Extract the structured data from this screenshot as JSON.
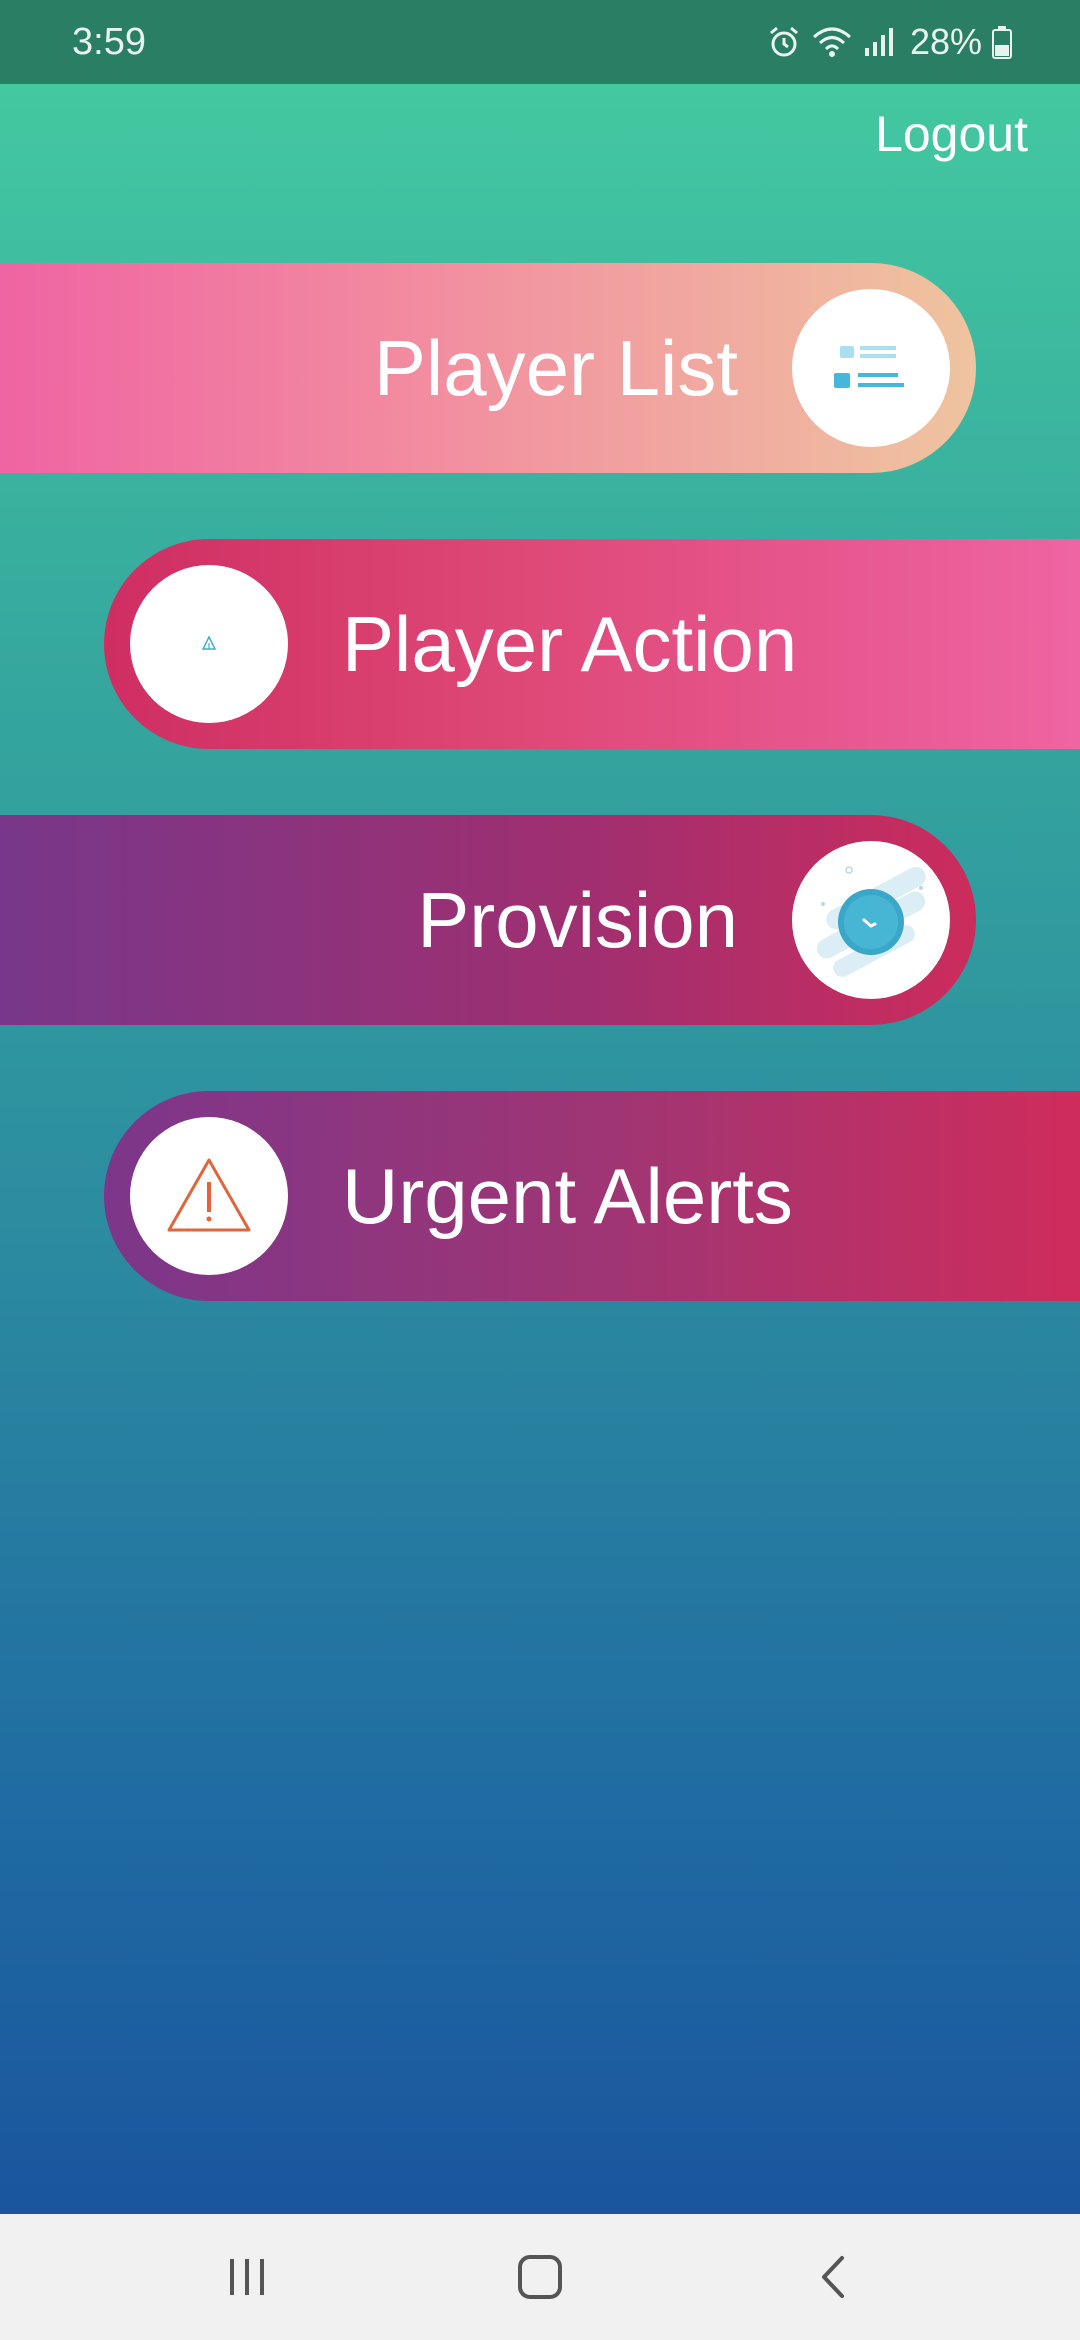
{
  "status_bar": {
    "time": "3:59",
    "battery_percent": "28%",
    "icons": [
      "alarm-icon",
      "wifi-icon",
      "signal-icon",
      "battery-icon"
    ]
  },
  "header": {
    "logout_label": "Logout"
  },
  "menu": {
    "items": [
      {
        "label": "Player List",
        "icon": "player-list-icon"
      },
      {
        "label": "Player Action",
        "icon": "player-action-icon"
      },
      {
        "label": "Provision",
        "icon": "clock-icon"
      },
      {
        "label": "Urgent Alerts",
        "icon": "warning-icon"
      }
    ]
  },
  "nav_bar": {
    "icons": [
      "recent-apps-icon",
      "home-icon",
      "back-icon"
    ]
  },
  "colors": {
    "status_bar": "#2a7e63",
    "background_top": "#43c8a0",
    "background_bottom": "#1a559d",
    "player_list": "#ef64a2",
    "player_action": "#cf2e62",
    "provision": "#78378a",
    "urgent_alerts": "#cf2c5c",
    "warning_icon": "#e0643c"
  }
}
